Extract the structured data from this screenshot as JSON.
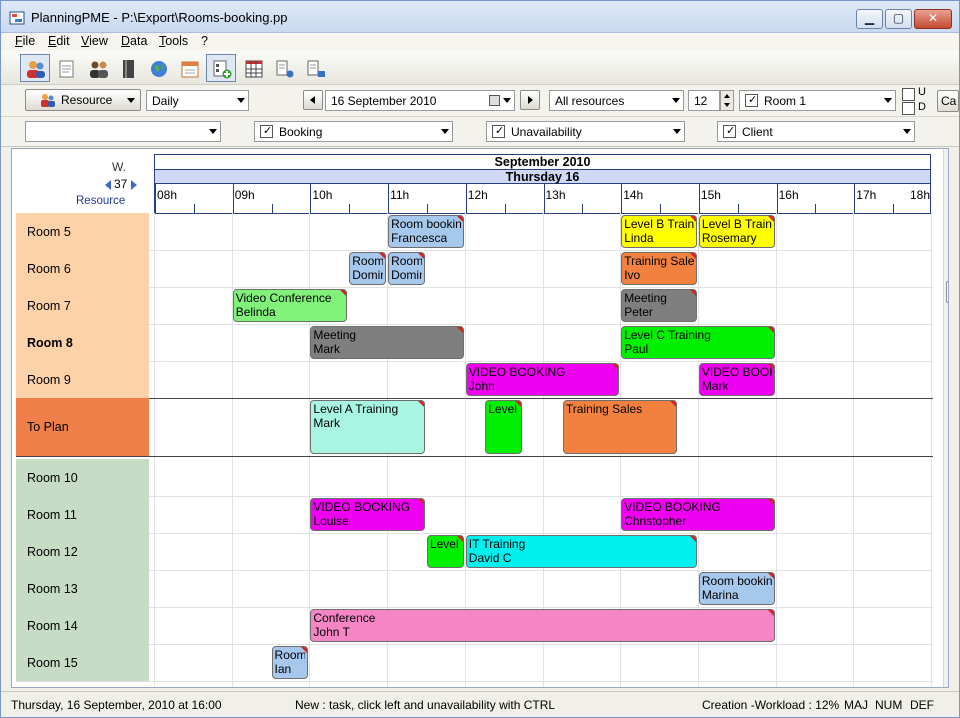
{
  "window": {
    "title": "PlanningPME - P:\\Export\\Rooms-booking.pp",
    "min_glyph": "▁",
    "max_glyph": "▢",
    "close_glyph": "✕"
  },
  "menu": [
    "File",
    "Edit",
    "View",
    "Data",
    "Tools",
    "?"
  ],
  "toolbar": {
    "resource_button": "Resource",
    "view_mode": "Daily",
    "date": "16 September 2010",
    "resource_filter": "All resources",
    "count": "12",
    "room_filter": "Room 1",
    "check_u": "U",
    "check_d": "D",
    "cut_button": "Ca",
    "filter1": "",
    "filter_booking": "Booking",
    "filter_unavailability": "Unavailability",
    "filter_client": "Client"
  },
  "planner": {
    "week_label": "W.",
    "week_number": "37",
    "resource_label": "Resource",
    "month": "September 2010",
    "day": "Thursday 16",
    "hours": [
      "08h",
      "09h",
      "10h",
      "11h",
      "12h",
      "13h",
      "14h",
      "15h",
      "16h",
      "17h",
      "18h"
    ],
    "rows": [
      {
        "label": "Room 5",
        "bold": false,
        "color": "#fdd2a8"
      },
      {
        "label": "Room 6",
        "bold": false,
        "color": "#fdd2a8"
      },
      {
        "label": "Room 7",
        "bold": false,
        "color": "#fdd2a8"
      },
      {
        "label": "Room  8",
        "bold": true,
        "color": "#fdd2a8"
      },
      {
        "label": "Room 9",
        "bold": false,
        "color": "#fdd2a8"
      },
      {
        "label": "To Plan",
        "bold": false,
        "color": "#f0804a"
      },
      {
        "label": "Room 10",
        "bold": false,
        "color": "#c6dcc4"
      },
      {
        "label": "Room 11",
        "bold": false,
        "color": "#c6dcc4"
      },
      {
        "label": "Room 12",
        "bold": false,
        "color": "#c6dcc4"
      },
      {
        "label": "Room 13",
        "bold": false,
        "color": "#c6dcc4"
      },
      {
        "label": "Room 14",
        "bold": false,
        "color": "#c6dcc4"
      },
      {
        "label": "Room 15",
        "bold": false,
        "color": "#c6dcc4"
      }
    ],
    "tasks": [
      {
        "row": 0,
        "start": 11.0,
        "end": 12.0,
        "t1": "Room booking",
        "t2": "Francesca",
        "color": "#a6c8ec"
      },
      {
        "row": 0,
        "start": 14.0,
        "end": 15.0,
        "t1": "Level B Training",
        "t2": "Linda",
        "color": "#ffff00"
      },
      {
        "row": 0,
        "start": 15.0,
        "end": 16.0,
        "t1": "Level B Training",
        "t2": "Rosemary",
        "color": "#ffff00"
      },
      {
        "row": 1,
        "start": 10.5,
        "end": 11.0,
        "t1": "Room booking",
        "t2": "Dominique",
        "color": "#a6c8ec"
      },
      {
        "row": 1,
        "start": 11.0,
        "end": 11.5,
        "t1": "Room booking",
        "t2": "Dominique",
        "color": "#a6c8ec"
      },
      {
        "row": 1,
        "start": 14.0,
        "end": 15.0,
        "t1": "Training Sales",
        "t2": "Ivo",
        "color": "#f2813f"
      },
      {
        "row": 2,
        "start": 9.0,
        "end": 10.5,
        "t1": "Video Conference",
        "t2": "Belinda",
        "color": "#80f27a"
      },
      {
        "row": 2,
        "start": 14.0,
        "end": 15.0,
        "t1": "Meeting",
        "t2": "Peter",
        "color": "#7f7f7f"
      },
      {
        "row": 3,
        "start": 10.0,
        "end": 12.0,
        "t1": "Meeting",
        "t2": "Mark",
        "color": "#7f7f7f"
      },
      {
        "row": 3,
        "start": 14.0,
        "end": 16.0,
        "t1": "Level C Training",
        "t2": "Paul",
        "color": "#00f000"
      },
      {
        "row": 4,
        "start": 12.0,
        "end": 14.0,
        "t1": "VIDEO BOOKING",
        "t2": "John",
        "color": "#f000f0"
      },
      {
        "row": 4,
        "start": 15.0,
        "end": 16.0,
        "t1": "VIDEO BOOKING",
        "t2": "Mark",
        "color": "#f000f0"
      },
      {
        "row": 5,
        "start": 10.0,
        "end": 11.5,
        "t1": "Level A Training",
        "t2": "Mark",
        "color": "#a8f5e2"
      },
      {
        "row": 5,
        "start": 12.25,
        "end": 12.75,
        "t1": "Level A Training",
        "t2": "",
        "color": "#00f000"
      },
      {
        "row": 5,
        "start": 13.25,
        "end": 14.75,
        "t1": "Training Sales",
        "t2": "",
        "color": "#f2813f"
      },
      {
        "row": 7,
        "start": 10.0,
        "end": 11.5,
        "t1": "VIDEO BOOKING",
        "t2": "Louise",
        "color": "#f000f0"
      },
      {
        "row": 7,
        "start": 14.0,
        "end": 16.0,
        "t1": "VIDEO BOOKING",
        "t2": "Christopher",
        "color": "#f000f0"
      },
      {
        "row": 8,
        "start": 11.5,
        "end": 12.0,
        "t1": "Level A Training",
        "t2": "",
        "color": "#00f000"
      },
      {
        "row": 8,
        "start": 12.0,
        "end": 15.0,
        "t1": "IT Training",
        "t2": "David C",
        "color": "#00f0f0"
      },
      {
        "row": 9,
        "start": 15.0,
        "end": 16.0,
        "t1": "Room booking",
        "t2": "Marina",
        "color": "#a6c8ec"
      },
      {
        "row": 10,
        "start": 10.0,
        "end": 16.0,
        "t1": "Conference",
        "t2": "John T",
        "color": "#f585c4"
      },
      {
        "row": 11,
        "start": 9.5,
        "end": 10.0,
        "t1": "Room booking",
        "t2": "Ian",
        "color": "#a6c8ec"
      }
    ]
  },
  "status": {
    "left": "Thursday, 16 September, 2010 at 16:00",
    "middle": "New : task, click left and unavailability with CTRL",
    "right": "Creation -Workload : 12%",
    "maj": "MAJ",
    "num": "NUM",
    "def": "DEF"
  }
}
